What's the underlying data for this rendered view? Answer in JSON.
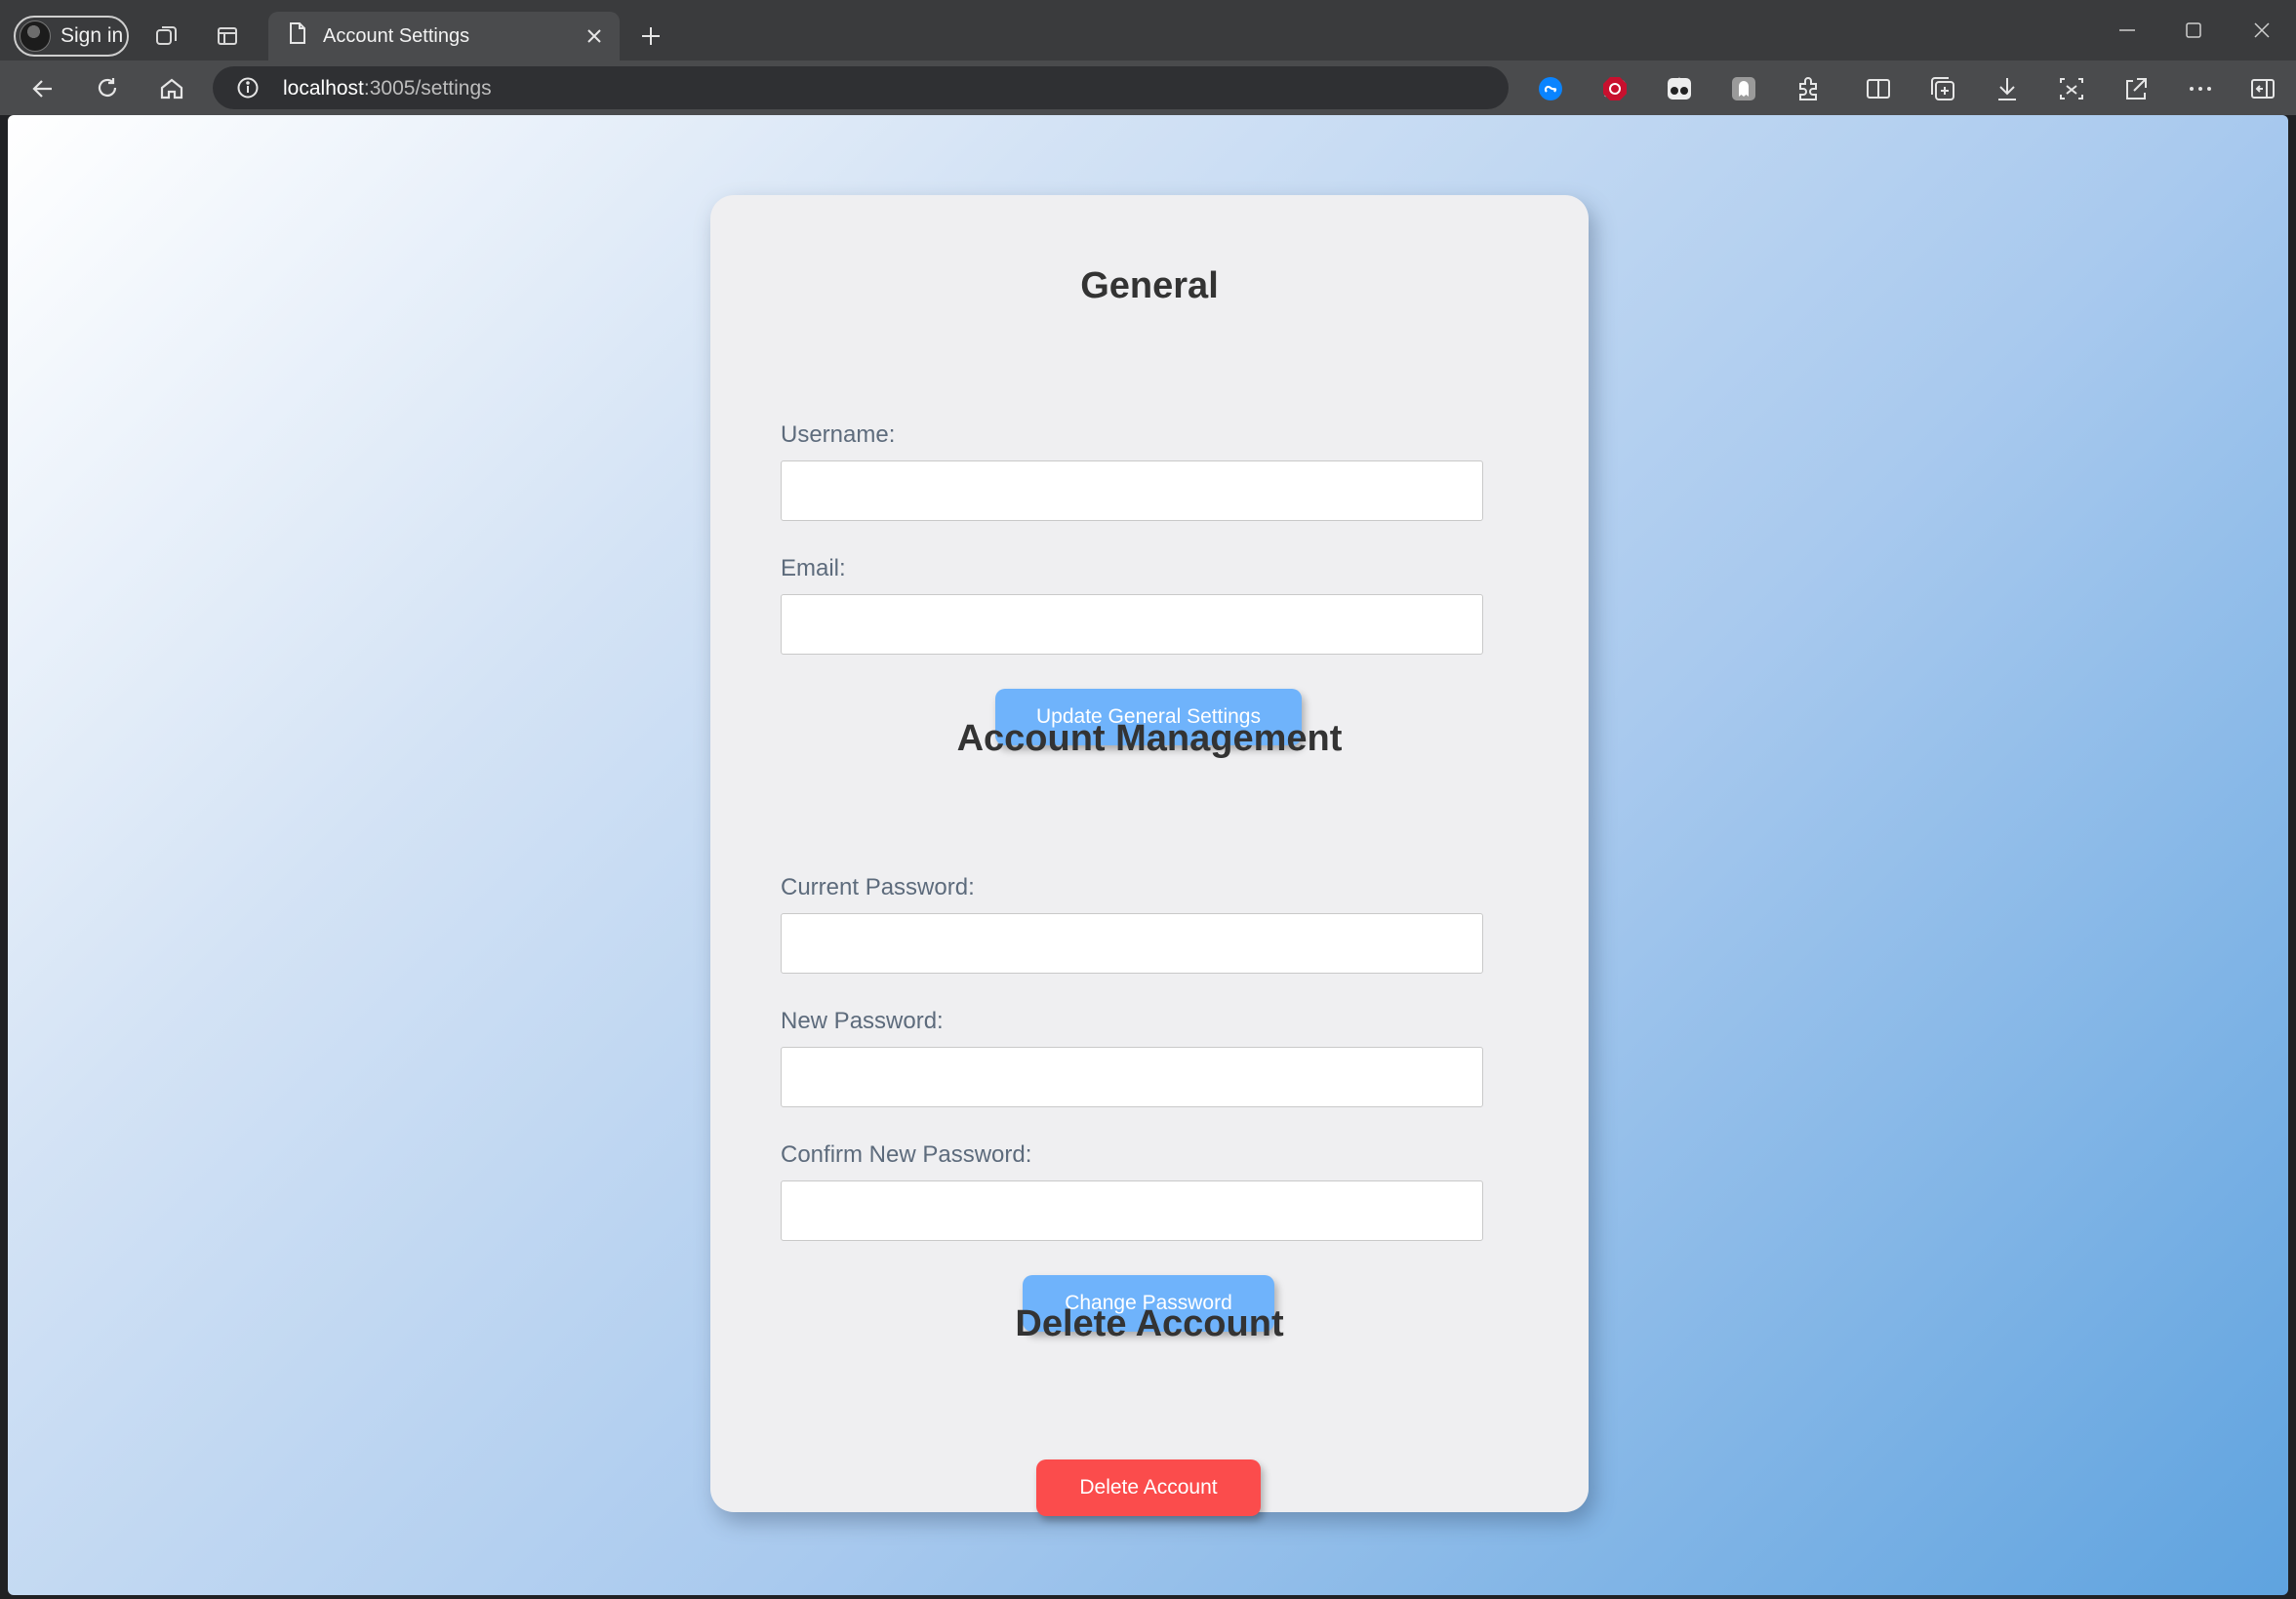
{
  "browser": {
    "profile_label": "Sign in",
    "tab_title": "Account Settings",
    "url_host": "localhost",
    "url_path": ":3005/settings",
    "icons": [
      "workspaces-icon",
      "tab-actions-icon",
      "page-icon",
      "close-icon",
      "new-tab-icon",
      "back-icon",
      "refresh-icon",
      "home-icon",
      "info-icon",
      "read-aloud-icon",
      "favorite-star-icon",
      "shazam-extension-icon",
      "adblock-extension-icon",
      "glasses-extension-icon",
      "ghostery-extension-icon",
      "extensions-puzzle-icon",
      "split-screen-icon",
      "collections-icon",
      "downloads-icon",
      "screenshot-icon",
      "share-icon",
      "more-icon",
      "sidebar-icon"
    ]
  },
  "settings": {
    "general": {
      "title": "General",
      "username_label": "Username:",
      "username_value": "",
      "email_label": "Email:",
      "email_value": "",
      "submit_label": "Update General Settings"
    },
    "account_management": {
      "title": "Account Management",
      "current_password_label": "Current Password:",
      "new_password_label": "New Password:",
      "confirm_password_label": "Confirm New Password:",
      "submit_label": "Change Password"
    },
    "delete_account": {
      "title": "Delete Account",
      "button_label": "Delete Account"
    }
  },
  "colors": {
    "primary_button": "#6fb3fb",
    "danger_button": "#fb4c4c",
    "card_background": "#efeff1",
    "heading_text": "#333333",
    "label_text": "#5d6b7c"
  }
}
